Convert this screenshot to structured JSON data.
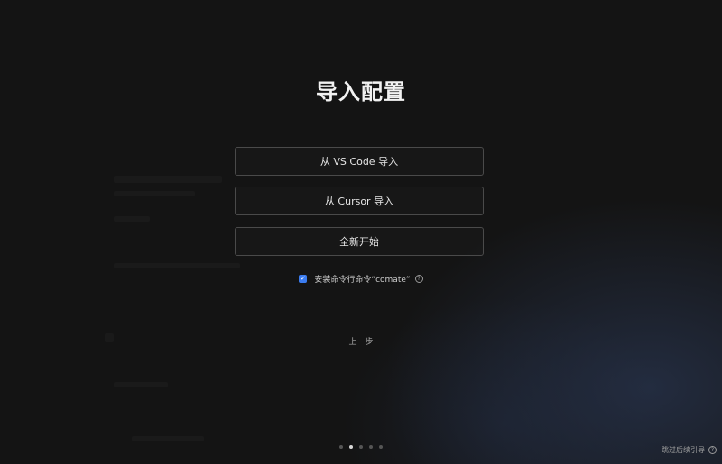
{
  "title": "导入配置",
  "options": [
    {
      "label": "从 VS Code 导入"
    },
    {
      "label": "从 Cursor 导入"
    },
    {
      "label": "全新开始"
    }
  ],
  "cli_option": {
    "label": "安装命令行命令“comate”",
    "checked": true,
    "checkmark": "✓",
    "help_icon": "?"
  },
  "prev_label": "上一步",
  "pagination": {
    "total": 5,
    "current": 2
  },
  "skip_label": "跳过后续引导",
  "skip_help_icon": "?",
  "colors": {
    "background": "#141414",
    "accent": "#3b7cf0",
    "button_border": "#4a4a4a"
  }
}
